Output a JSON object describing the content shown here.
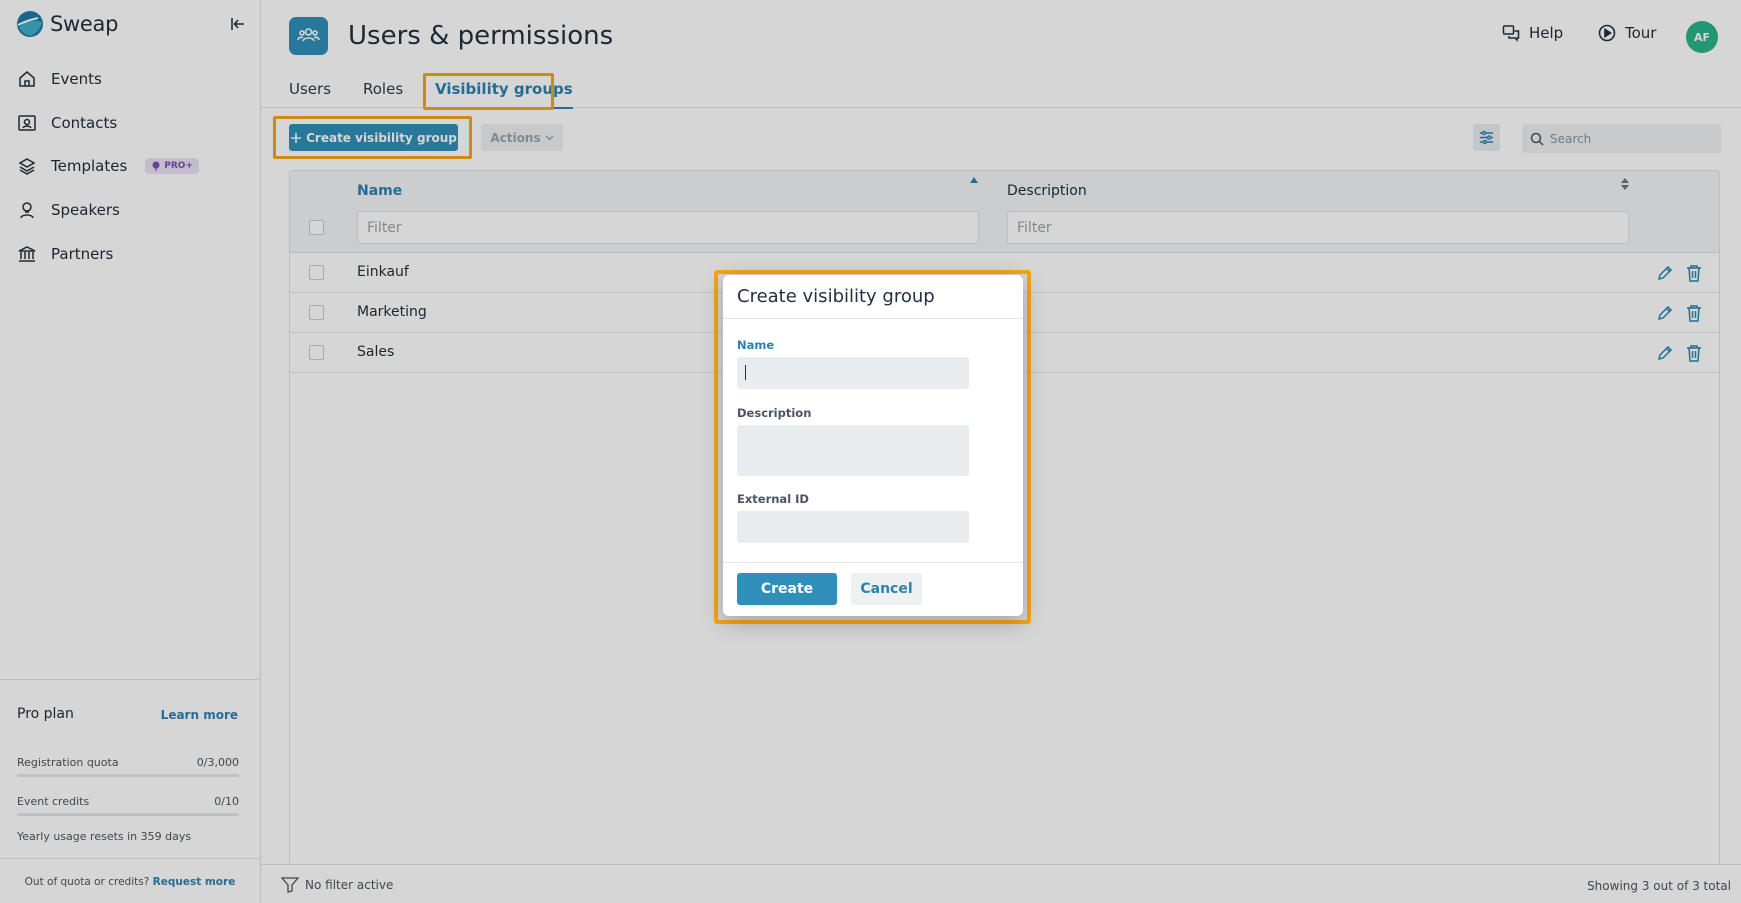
{
  "brand": {
    "name": "Sweap",
    "accent": "#2f8fb8",
    "highlight": "#f4a716"
  },
  "sidebar": {
    "items": [
      {
        "label": "Events",
        "icon": "home-icon"
      },
      {
        "label": "Contacts",
        "icon": "contact-card-icon"
      },
      {
        "label": "Templates",
        "icon": "layers-icon",
        "badge": "PRO+"
      },
      {
        "label": "Speakers",
        "icon": "speaker-icon"
      },
      {
        "label": "Partners",
        "icon": "bank-icon"
      }
    ],
    "plan": {
      "title": "Pro plan",
      "learn_more": "Learn more",
      "registration_label": "Registration quota",
      "registration_value": "0/3,000",
      "credits_label": "Event credits",
      "credits_value": "0/10",
      "resets": "Yearly usage resets in 359 days",
      "out_of_quota": "Out of quota or credits?",
      "request_more": "Request more"
    }
  },
  "header": {
    "title": "Users & permissions",
    "help": "Help",
    "tour": "Tour",
    "avatar": "AF"
  },
  "tabs": [
    {
      "label": "Users",
      "active": false
    },
    {
      "label": "Roles",
      "active": false
    },
    {
      "label": "Visibility groups",
      "active": true
    }
  ],
  "toolbar": {
    "create_label": "Create visibility group",
    "actions_label": "Actions",
    "search_placeholder": "Search"
  },
  "table": {
    "columns": [
      "Name",
      "Description"
    ],
    "filter_placeholder": "Filter",
    "rows": [
      {
        "name": "Einkauf",
        "description": ""
      },
      {
        "name": "Marketing",
        "description": ""
      },
      {
        "name": "Sales",
        "description": ""
      }
    ]
  },
  "footer": {
    "filter_status": "No filter active",
    "showing": "Showing 3 out of 3 total"
  },
  "dialog": {
    "title": "Create visibility group",
    "name_label": "Name",
    "description_label": "Description",
    "external_id_label": "External ID",
    "name_value": "",
    "description_value": "",
    "external_id_value": "",
    "create_label": "Create",
    "cancel_label": "Cancel"
  }
}
